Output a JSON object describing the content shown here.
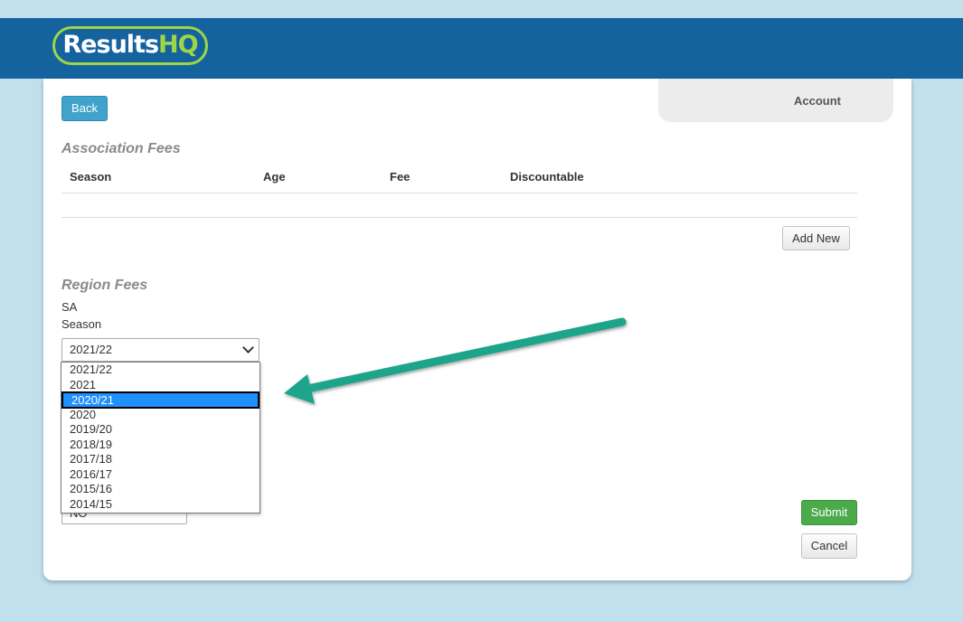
{
  "header": {
    "logo_main": "Results",
    "logo_accent": "HQ"
  },
  "account": {
    "label": "Account"
  },
  "buttons": {
    "back": "Back",
    "add_new": "Add New",
    "submit": "Submit",
    "cancel": "Cancel"
  },
  "association_fees": {
    "title": "Association Fees",
    "columns": [
      "Season",
      "Age",
      "Fee",
      "Discountable"
    ]
  },
  "region_fees": {
    "title": "Region Fees",
    "region": "SA",
    "season_label": "Season",
    "season_selected": "2021/22",
    "season_options": [
      "2021/22",
      "2021",
      "2020/21",
      "2020",
      "2019/20",
      "2018/19",
      "2017/18",
      "2016/17",
      "2015/16",
      "2014/15"
    ],
    "highlighted_option": "2020/21",
    "second_select_value": "NO"
  },
  "colors": {
    "header_bg": "#14639f",
    "logo_accent": "#9cd648",
    "back_button": "#3fa3cc",
    "submit_button": "#4bab4b",
    "highlight": "#1e90ff",
    "arrow": "#1aa58a"
  },
  "icons": {
    "select_chevron": "chevron-down-icon",
    "annotation": "arrow-icon"
  }
}
